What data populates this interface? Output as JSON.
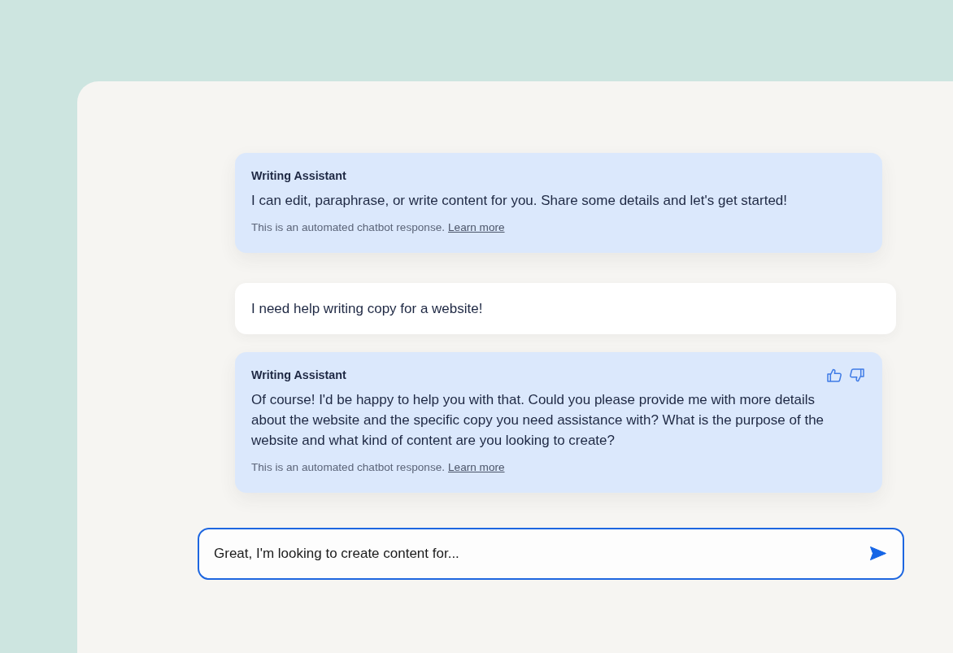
{
  "messages": [
    {
      "kind": "bot",
      "sender": "Writing Assistant",
      "text": "I can edit, paraphrase, or write content for you. Share some details and let's get started!",
      "disclaimer": "This is an automated chatbot response.",
      "link": "Learn more",
      "feedback": false
    },
    {
      "kind": "user",
      "text": "I need help writing copy for a website!"
    },
    {
      "kind": "bot",
      "sender": "Writing Assistant",
      "text": "Of course! I'd be happy to help you with that. Could you please provide me with more details about the website and the specific copy you need assistance with? What is the purpose of the website and what kind of content are you looking to create?",
      "disclaimer": "This is an automated chatbot response.",
      "link": "Learn more",
      "feedback": true
    }
  ],
  "composer": {
    "value": "Great, I'm looking to create content for...",
    "focused": true
  }
}
